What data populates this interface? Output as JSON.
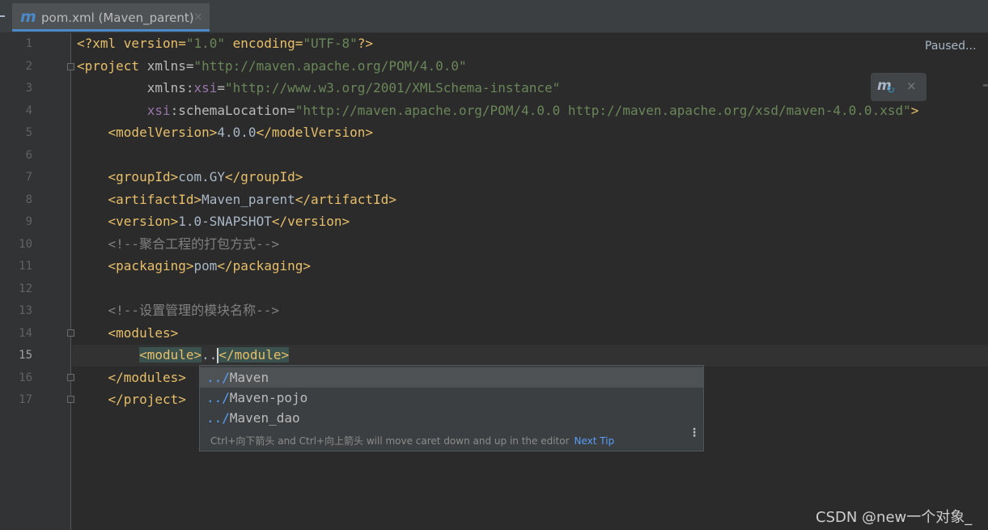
{
  "tab": {
    "icon": "maven-m-icon",
    "logo_text": "m",
    "title": "pom.xml (Maven_parent)",
    "close": "×"
  },
  "status": {
    "paused": "Paused..."
  },
  "maven_popup": {
    "icon": "maven-reload-icon",
    "icon_text": "m",
    "refresh_glyph": "↻",
    "close": "×"
  },
  "editor": {
    "current_line": "15",
    "line_numbers": [
      "1",
      "2",
      "3",
      "4",
      "5",
      "6",
      "7",
      "8",
      "9",
      "10",
      "11",
      "12",
      "13",
      "14",
      "15",
      "16",
      "17"
    ],
    "l1": {
      "a": "<?xml version=",
      "b": "\"1.0\"",
      "c": " encoding=",
      "d": "\"UTF-8\"",
      "e": "?>"
    },
    "l2": {
      "a": "<project",
      "b": " xmlns=",
      "c": "\"http://maven.apache.org/POM/4.0.0\""
    },
    "l3": {
      "a": "xmlns:",
      "b": "xsi",
      "c": "=",
      "d": "\"http://www.w3.org/2001/XMLSchema-instance\""
    },
    "l4": {
      "a": "xsi",
      "b": ":schemaLocation=",
      "c": "\"http://maven.apache.org/POM/4.0.0 http://maven.apache.org/xsd/maven-4.0.0.xsd\"",
      "d": ">"
    },
    "l5": {
      "a": "<modelVersion>",
      "b": "4.0.0",
      "c": "</modelVersion>"
    },
    "l7": {
      "a": "<groupId>",
      "b": "com.GY",
      "c": "</groupId>"
    },
    "l8": {
      "a": "<artifactId>",
      "b": "Maven_parent",
      "c": "</artifactId>"
    },
    "l9": {
      "a": "<version>",
      "b": "1.0-SNAPSHOT",
      "c": "</version>"
    },
    "l10": "<!--聚合工程的打包方式-->",
    "l11": {
      "a": "<packaging>",
      "b": "pom",
      "c": "</packaging>"
    },
    "l13": "<!--设置管理的模块名称-->",
    "l14": "<modules>",
    "l15": {
      "a": "<module>",
      "b": "..",
      "c": "</module>"
    },
    "l16": "</modules>",
    "l17": "</project>"
  },
  "completion": {
    "items": [
      {
        "match": "../",
        "rest": "Maven"
      },
      {
        "match": "../",
        "rest": "Maven-pojo"
      },
      {
        "match": "../",
        "rest": "Maven_dao"
      }
    ],
    "tip": "Ctrl+向下箭头 and Ctrl+向上箭头 will move caret down and up in the editor",
    "next_tip": "Next Tip",
    "more_icon": "vertical-dots-icon",
    "more_glyph": "⋮"
  },
  "watermark": "CSDN @new一个对象_"
}
